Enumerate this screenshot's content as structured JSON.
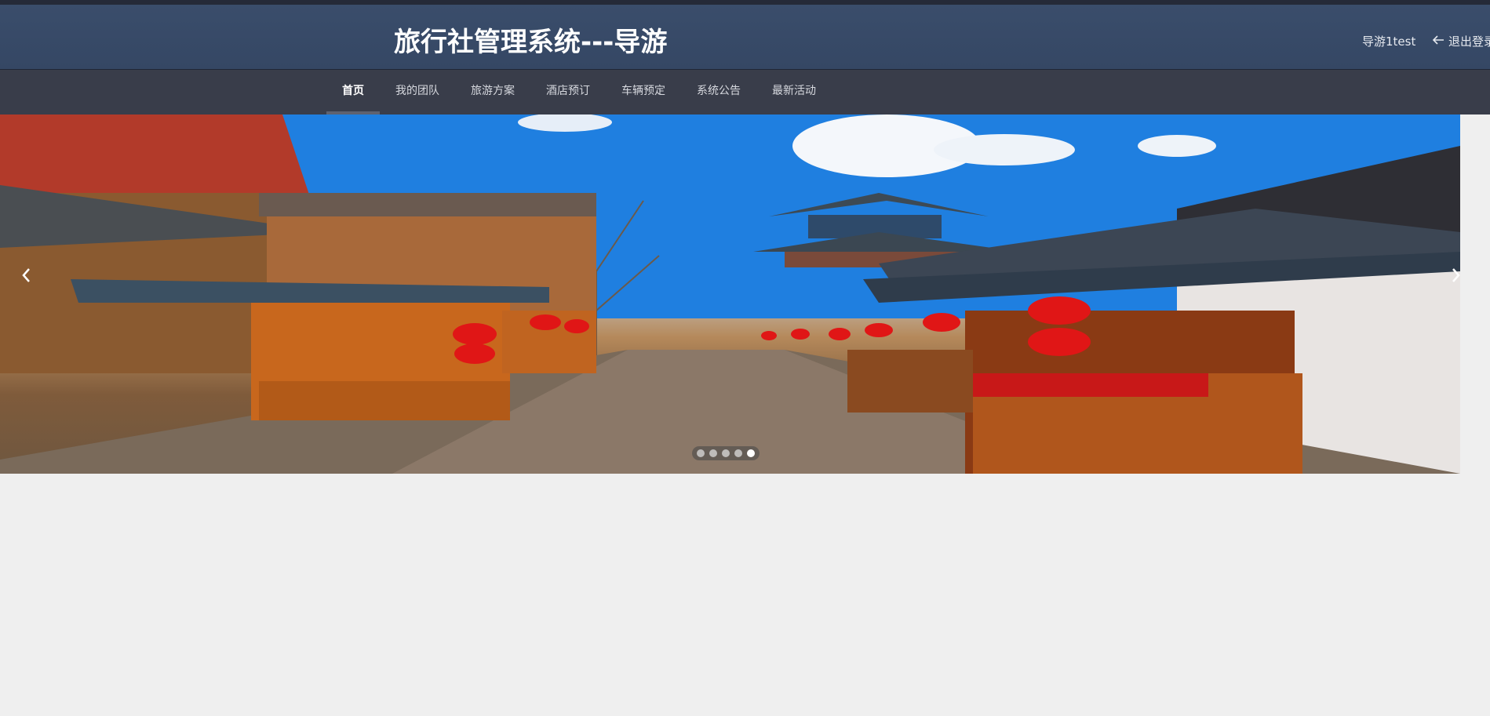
{
  "header": {
    "title": "旅行社管理系统---导游",
    "user_label": "导游1test",
    "logout_label": "退出登录"
  },
  "nav": {
    "items": [
      {
        "label": "首页",
        "active": true
      },
      {
        "label": "我的团队",
        "active": false
      },
      {
        "label": "旅游方案",
        "active": false
      },
      {
        "label": "酒店预订",
        "active": false
      },
      {
        "label": "车辆预定",
        "active": false
      },
      {
        "label": "系统公告",
        "active": false
      },
      {
        "label": "最新活动",
        "active": false
      }
    ]
  },
  "carousel": {
    "slide_count": 5,
    "active_index": 4,
    "prev_icon": "chevron-left-icon",
    "next_icon": "chevron-right-icon"
  },
  "colors": {
    "header_bg": "#3a4d6b",
    "nav_bg": "#393d4a",
    "page_bg": "#efefef"
  }
}
